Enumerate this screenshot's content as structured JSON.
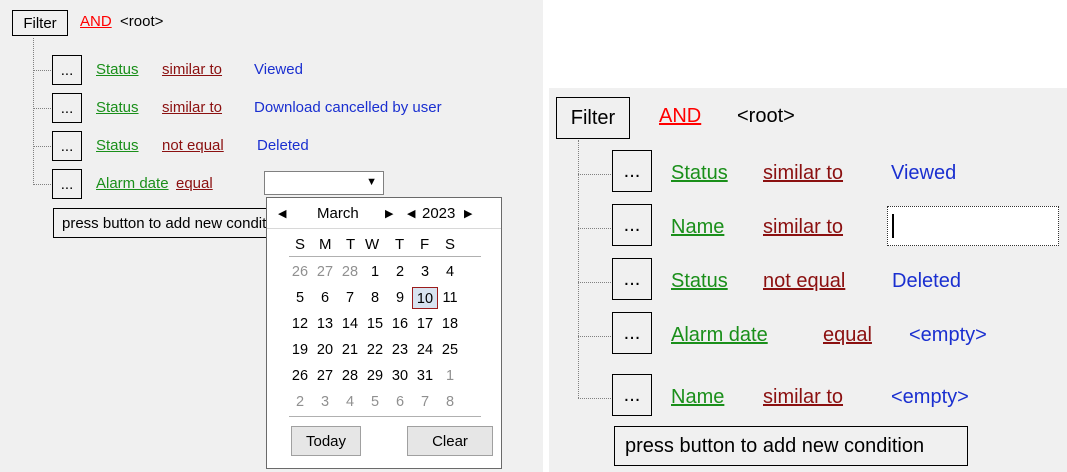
{
  "left": {
    "filter_label": "Filter",
    "operator": "AND",
    "root": "<root>",
    "ellipsis": "...",
    "rows": [
      {
        "field": "Status",
        "op": "similar to",
        "value": "Viewed"
      },
      {
        "field": "Status",
        "op": "similar to",
        "value": "Download cancelled by user"
      },
      {
        "field": "Status",
        "op": "not equal",
        "value": "Deleted"
      },
      {
        "field": "Alarm date",
        "op": "equal",
        "value": ""
      }
    ],
    "add_button": "press button to add new condition"
  },
  "calendar": {
    "month": "March",
    "year": "2023",
    "weekdays": [
      "S",
      "M",
      "T",
      "W",
      "T",
      "F",
      "S"
    ],
    "weeks": [
      [
        "26",
        "27",
        "28",
        "1",
        "2",
        "3",
        "4"
      ],
      [
        "5",
        "6",
        "7",
        "8",
        "9",
        "10",
        "11"
      ],
      [
        "12",
        "13",
        "14",
        "15",
        "16",
        "17",
        "18"
      ],
      [
        "19",
        "20",
        "21",
        "22",
        "23",
        "24",
        "25"
      ],
      [
        "26",
        "27",
        "28",
        "29",
        "30",
        "31",
        "1"
      ],
      [
        "2",
        "3",
        "4",
        "5",
        "6",
        "7",
        "8"
      ]
    ],
    "selected_day": "10",
    "today_button": "Today",
    "clear_button": "Clear"
  },
  "right": {
    "filter_label": "Filter",
    "operator": "AND",
    "root": "<root>",
    "ellipsis": "...",
    "rows": [
      {
        "field": "Status",
        "op": "similar to",
        "value": "Viewed"
      },
      {
        "field": "Name",
        "op": "similar to",
        "value": ""
      },
      {
        "field": "Status",
        "op": "not equal",
        "value": "Deleted"
      },
      {
        "field": "Alarm date",
        "op": "equal",
        "value": "<empty>"
      },
      {
        "field": "Name",
        "op": "similar to",
        "value": "<empty>"
      }
    ],
    "add_button": "press button to add new condition"
  }
}
